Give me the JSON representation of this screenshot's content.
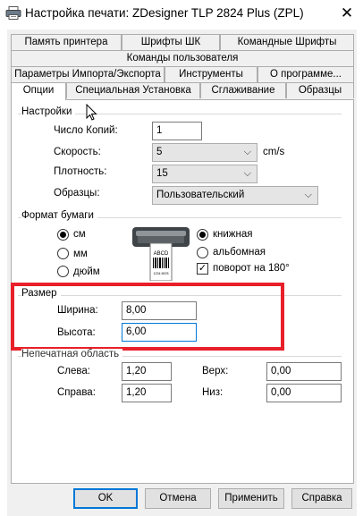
{
  "window": {
    "title": "Настройка печати: ZDesigner TLP 2824 Plus (ZPL)",
    "close_glyph": "✕"
  },
  "tabs": {
    "row1": [
      "Память принтера",
      "Шрифты ШК",
      "Командные Шрифты"
    ],
    "row2": [
      "Команды пользователя"
    ],
    "row3": [
      "Параметры Импорта/Экспорта",
      "Инструменты",
      "О программе..."
    ],
    "row4": [
      "Опции",
      "Специальная Установка",
      "Сглаживание",
      "Образцы"
    ]
  },
  "settings": {
    "group_label": "Настройки",
    "copies_label": "Число Копий:",
    "copies_value": "1",
    "speed_label": "Скорость:",
    "speed_value": "5",
    "speed_unit": "cm/s",
    "density_label": "Плотность:",
    "density_value": "15",
    "samples_label": "Образцы:",
    "samples_value": "Пользовательский"
  },
  "paper_format": {
    "group_label": "Формат бумаги",
    "units": [
      {
        "label": "см",
        "selected": true
      },
      {
        "label": "мм",
        "selected": false
      },
      {
        "label": "дюйм",
        "selected": false
      }
    ],
    "orientation": [
      {
        "label": "книжная",
        "selected": true
      },
      {
        "label": "альбомная",
        "selected": false
      }
    ],
    "rotate_label": "поворот на 180°",
    "rotate_checked": true,
    "label_text": "ABCD",
    "label_small": "1234 5678"
  },
  "size": {
    "group_label": "Размер",
    "width_label": "Ширина:",
    "width_value": "8,00",
    "height_label": "Высота:",
    "height_value": "6,00"
  },
  "unprintable": {
    "group_label": "Непечатная область",
    "left_label": "Слева:",
    "left_value": "1,20",
    "right_label": "Справа:",
    "right_value": "1,20",
    "top_label": "Верх:",
    "top_value": "0,00",
    "bottom_label": "Низ:",
    "bottom_value": "0,00"
  },
  "buttons": {
    "ok": "OK",
    "cancel": "Отмена",
    "apply": "Применить",
    "help": "Справка"
  },
  "colors": {
    "highlight": "#e8202a",
    "focus": "#0078d7"
  }
}
